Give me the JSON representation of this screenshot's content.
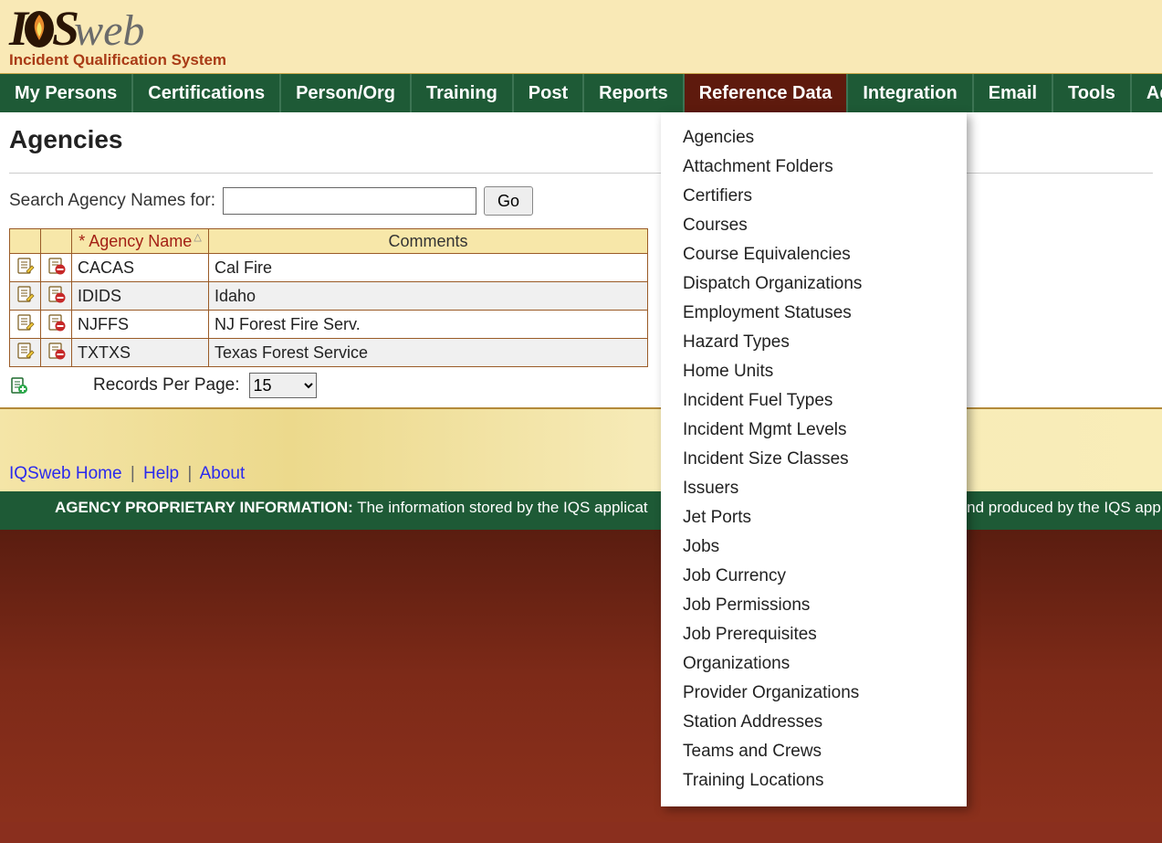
{
  "logo": {
    "prefix": "IQS",
    "suffix": "web",
    "subtitle": "Incident Qualification System"
  },
  "nav": {
    "items": [
      "My Persons",
      "Certifications",
      "Person/Org",
      "Training",
      "Post",
      "Reports",
      "Reference Data",
      "Integration",
      "Email",
      "Tools",
      "Admi"
    ],
    "active_index": 6
  },
  "dropdown": {
    "items": [
      "Agencies",
      "Attachment Folders",
      "Certifiers",
      "Courses",
      "Course Equivalencies",
      "Dispatch Organizations",
      "Employment Statuses",
      "Hazard Types",
      "Home Units",
      "Incident Fuel Types",
      "Incident Mgmt Levels",
      "Incident Size Classes",
      "Issuers",
      "Jet Ports",
      "Jobs",
      "Job Currency",
      "Job Permissions",
      "Job Prerequisites",
      "Organizations",
      "Provider Organizations",
      "Station Addresses",
      "Teams and Crews",
      "Training Locations"
    ]
  },
  "page": {
    "title": "Agencies",
    "search_label": "Search Agency Names for:",
    "go_label": "Go"
  },
  "grid": {
    "col_agency": "Agency Name",
    "col_comments": "Comments",
    "rows": [
      {
        "name": "CACAS",
        "comments": "Cal Fire"
      },
      {
        "name": "IDIDS",
        "comments": "Idaho"
      },
      {
        "name": "NJFFS",
        "comments": "NJ Forest Fire Serv."
      },
      {
        "name": "TXTXS",
        "comments": "Texas Forest Service"
      }
    ],
    "records_per_page_label": "Records Per Page:",
    "records_per_page_value": "15"
  },
  "footer_links": {
    "home": "IQSweb Home",
    "help": "Help",
    "about": "About"
  },
  "proprietary": {
    "bold": "AGENCY PROPRIETARY INFORMATION:",
    "text_left": " The information stored by the IQS applicat",
    "text_right": "nd produced by the IQS app"
  }
}
